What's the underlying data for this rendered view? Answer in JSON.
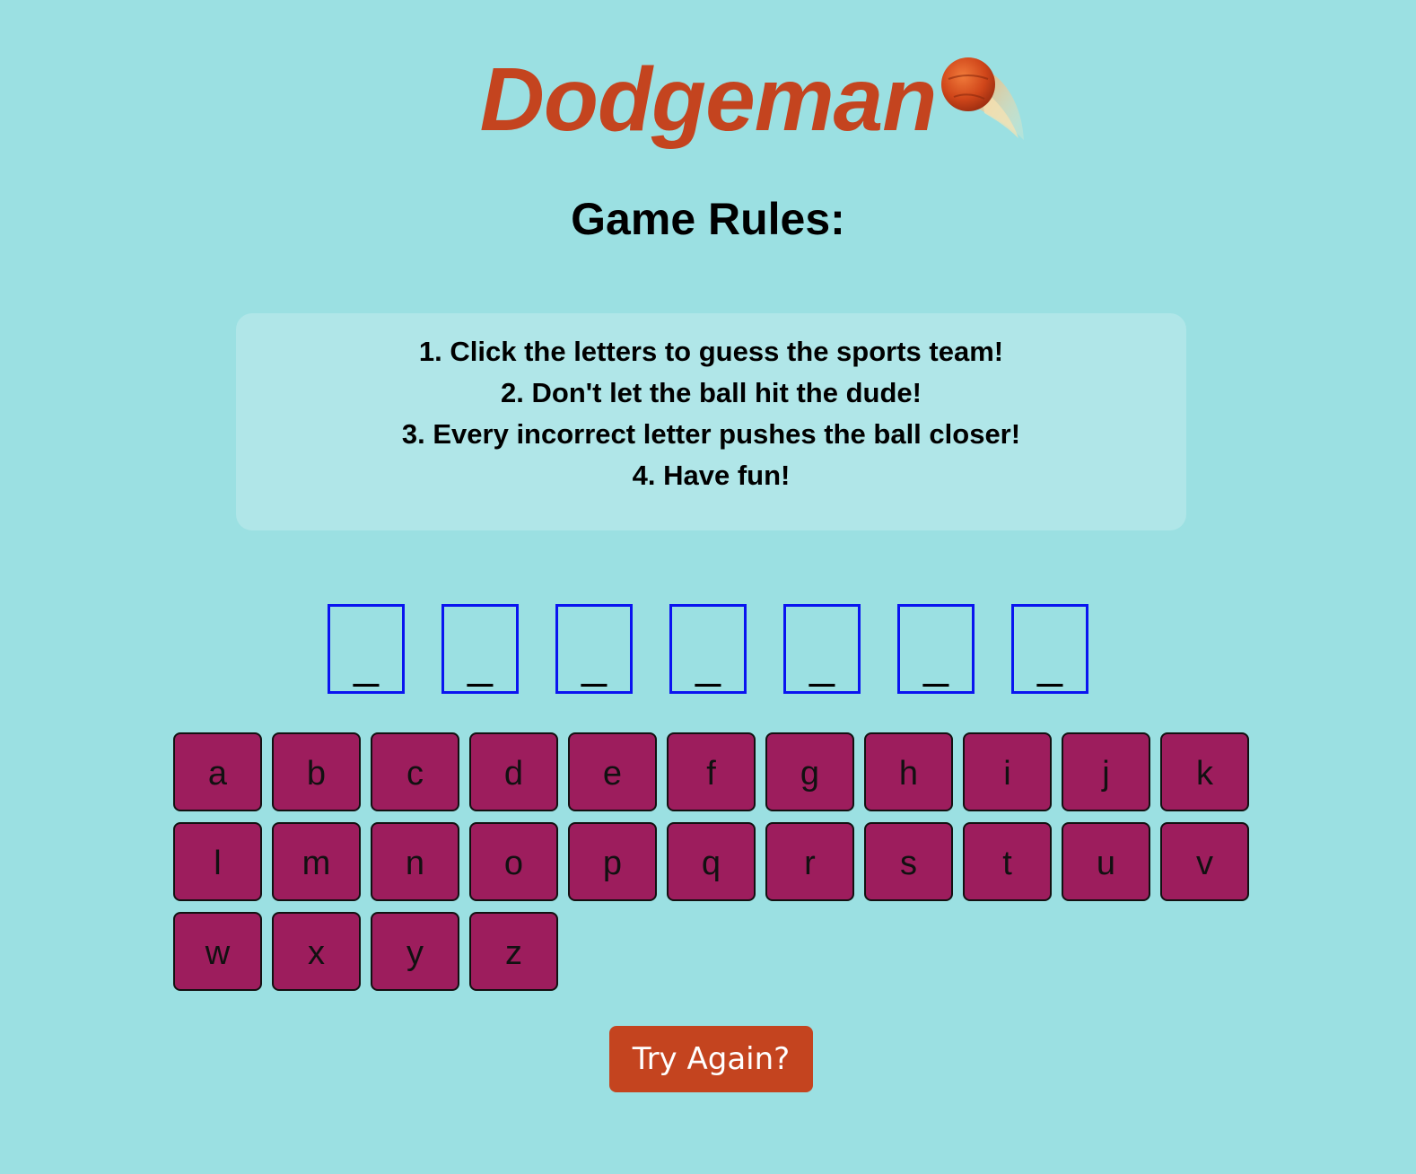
{
  "header": {
    "title": "Dodgeman"
  },
  "rules": {
    "heading": "Game Rules:",
    "items": [
      "1. Click the letters to guess the sports team!",
      "2. Don't let the ball hit the dude!",
      "3. Every incorrect letter pushes the ball closer!",
      "4. Have fun!"
    ]
  },
  "word": {
    "slots": [
      "_",
      "_",
      "_",
      "_",
      "_",
      "_",
      "_"
    ]
  },
  "keyboard": {
    "letters": [
      "a",
      "b",
      "c",
      "d",
      "e",
      "f",
      "g",
      "h",
      "i",
      "j",
      "k",
      "l",
      "m",
      "n",
      "o",
      "p",
      "q",
      "r",
      "s",
      "t",
      "u",
      "v",
      "w",
      "x",
      "y",
      "z"
    ]
  },
  "controls": {
    "try_again_label": "Try Again?"
  },
  "colors": {
    "background": "#9be0e2",
    "title": "#c4441f",
    "rules_box": "#b0e6e8",
    "slot_border": "#0a14f0",
    "key": "#9d1d5d",
    "try_again": "#c4441f"
  },
  "icons": {
    "logo_ball": "fireball-icon"
  }
}
